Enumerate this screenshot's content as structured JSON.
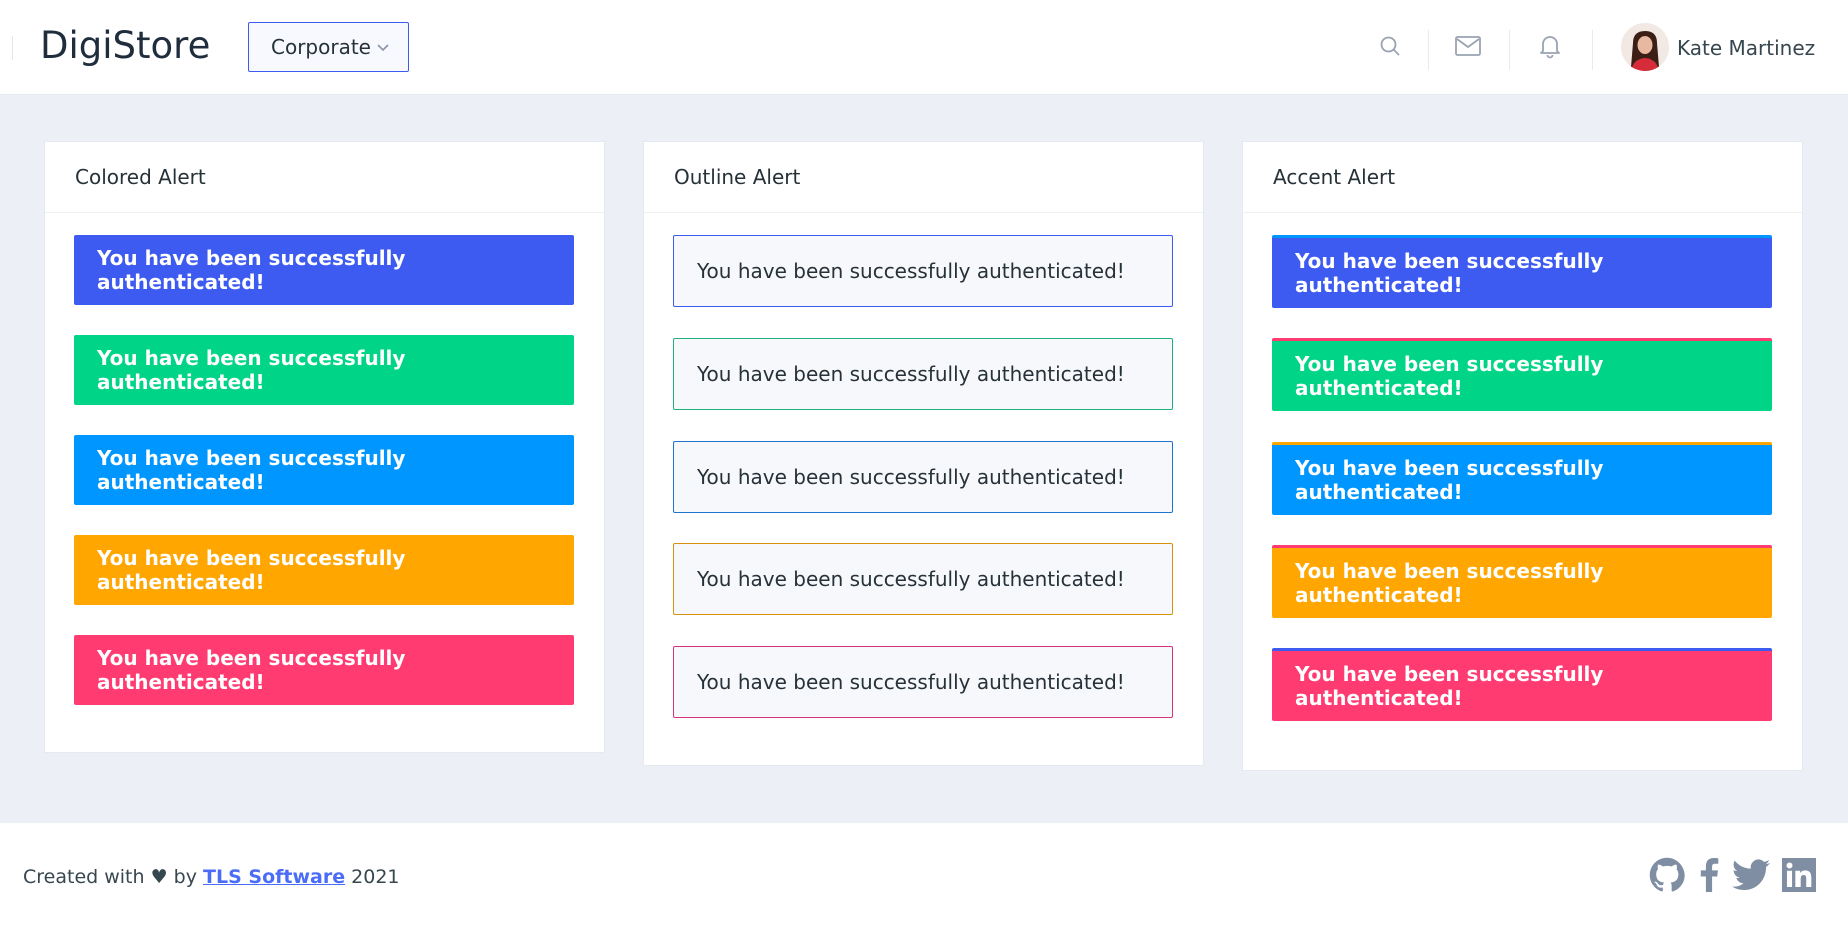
{
  "header": {
    "brand": "DigiStore",
    "workspace": "Corporate",
    "user_name": "Kate Martinez"
  },
  "icons": [
    "search-icon",
    "mail-icon",
    "bell-icon",
    "chevron-down-icon",
    "github-icon",
    "facebook-icon",
    "twitter-icon",
    "linkedin-icon"
  ],
  "colors": {
    "primary": "#3d5af1",
    "success": "#00d487",
    "info": "#0096ff",
    "warning": "#ffa600",
    "danger": "#ff3b71",
    "page_bg": "#ecf0f6"
  },
  "cards": {
    "colored": {
      "title": "Colored Alert",
      "alerts": [
        {
          "text": "You have been successfully authenticated!",
          "color": "#3d5af1"
        },
        {
          "text": "You have been successfully authenticated!",
          "color": "#00d487"
        },
        {
          "text": "You have been successfully authenticated!",
          "color": "#0096ff"
        },
        {
          "text": "You have been successfully authenticated!",
          "color": "#ffa600"
        },
        {
          "text": "You have been successfully authenticated!",
          "color": "#ff3b71"
        }
      ]
    },
    "outline": {
      "title": "Outline Alert",
      "alerts": [
        {
          "text": "You have been successfully authenticated!",
          "color": "#3d5af1"
        },
        {
          "text": "You have been successfully authenticated!",
          "color": "#20b07e"
        },
        {
          "text": "You have been successfully authenticated!",
          "color": "#1f74d0"
        },
        {
          "text": "You have been successfully authenticated!",
          "color": "#d6920a"
        },
        {
          "text": "You have been successfully authenticated!",
          "color": "#d6337c"
        }
      ]
    },
    "accent": {
      "title": "Accent Alert",
      "alerts": [
        {
          "text": "You have been successfully authenticated!",
          "color": "#3d5af1",
          "accent": "#0096ff"
        },
        {
          "text": "You have been successfully authenticated!",
          "color": "#00d487",
          "accent": "#ff3b71"
        },
        {
          "text": "You have been successfully authenticated!",
          "color": "#0096ff",
          "accent": "#ffa600"
        },
        {
          "text": "You have been successfully authenticated!",
          "color": "#ffa600",
          "accent": "#ff3b71"
        },
        {
          "text": "You have been successfully authenticated!",
          "color": "#ff3b71",
          "accent": "#3d5af1"
        }
      ]
    }
  },
  "footer": {
    "prefix": "Created with ♥ by",
    "company": "TLS Software",
    "year": "2021"
  }
}
